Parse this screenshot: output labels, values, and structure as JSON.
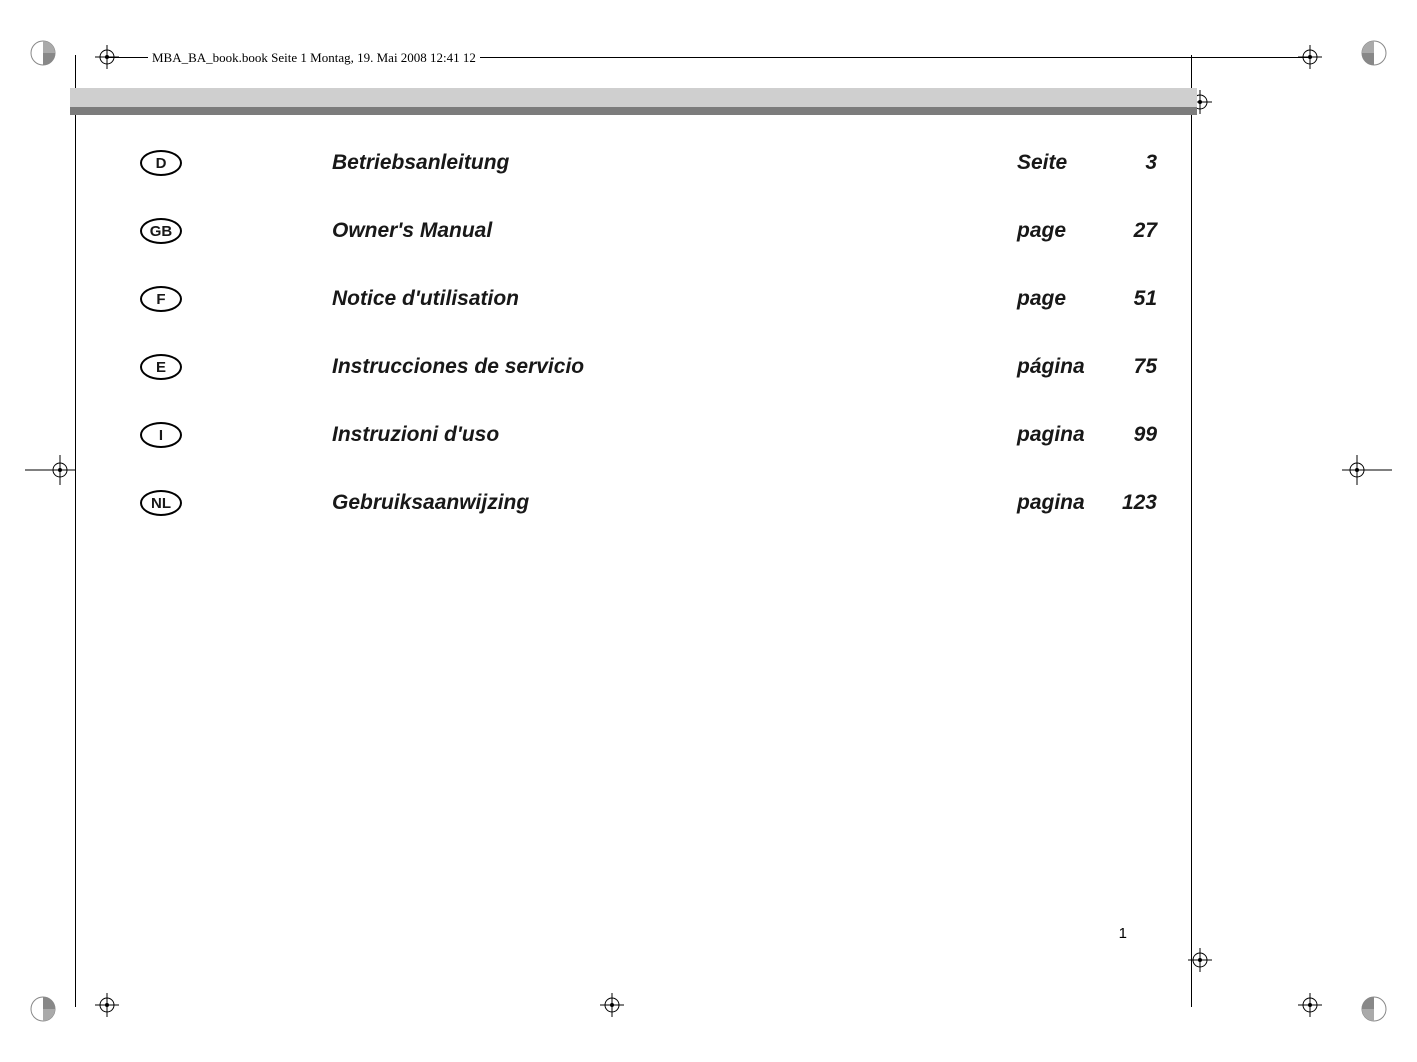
{
  "header": {
    "file_info": "MBA_BA_book.book  Seite 1  Montag, 19. Mai 2008  12:41 12"
  },
  "toc": {
    "rows": [
      {
        "lang_code": "D",
        "title": "Betriebsanleitung",
        "page_label": "Seite",
        "page_num": "3"
      },
      {
        "lang_code": "GB",
        "title": "Owner's Manual",
        "page_label": "page",
        "page_num": "27"
      },
      {
        "lang_code": "F",
        "title": "Notice d'utilisation",
        "page_label": "page",
        "page_num": "51"
      },
      {
        "lang_code": "E",
        "title": "Instrucciones de servicio",
        "page_label": "página",
        "page_num": "75"
      },
      {
        "lang_code": "I",
        "title": "Instruzioni d'uso",
        "page_label": "pagina",
        "page_num": "99"
      },
      {
        "lang_code": "NL",
        "title": "Gebruiksaanwijzing",
        "page_label": "pagina",
        "page_num": "123"
      }
    ]
  },
  "page_number": "1"
}
